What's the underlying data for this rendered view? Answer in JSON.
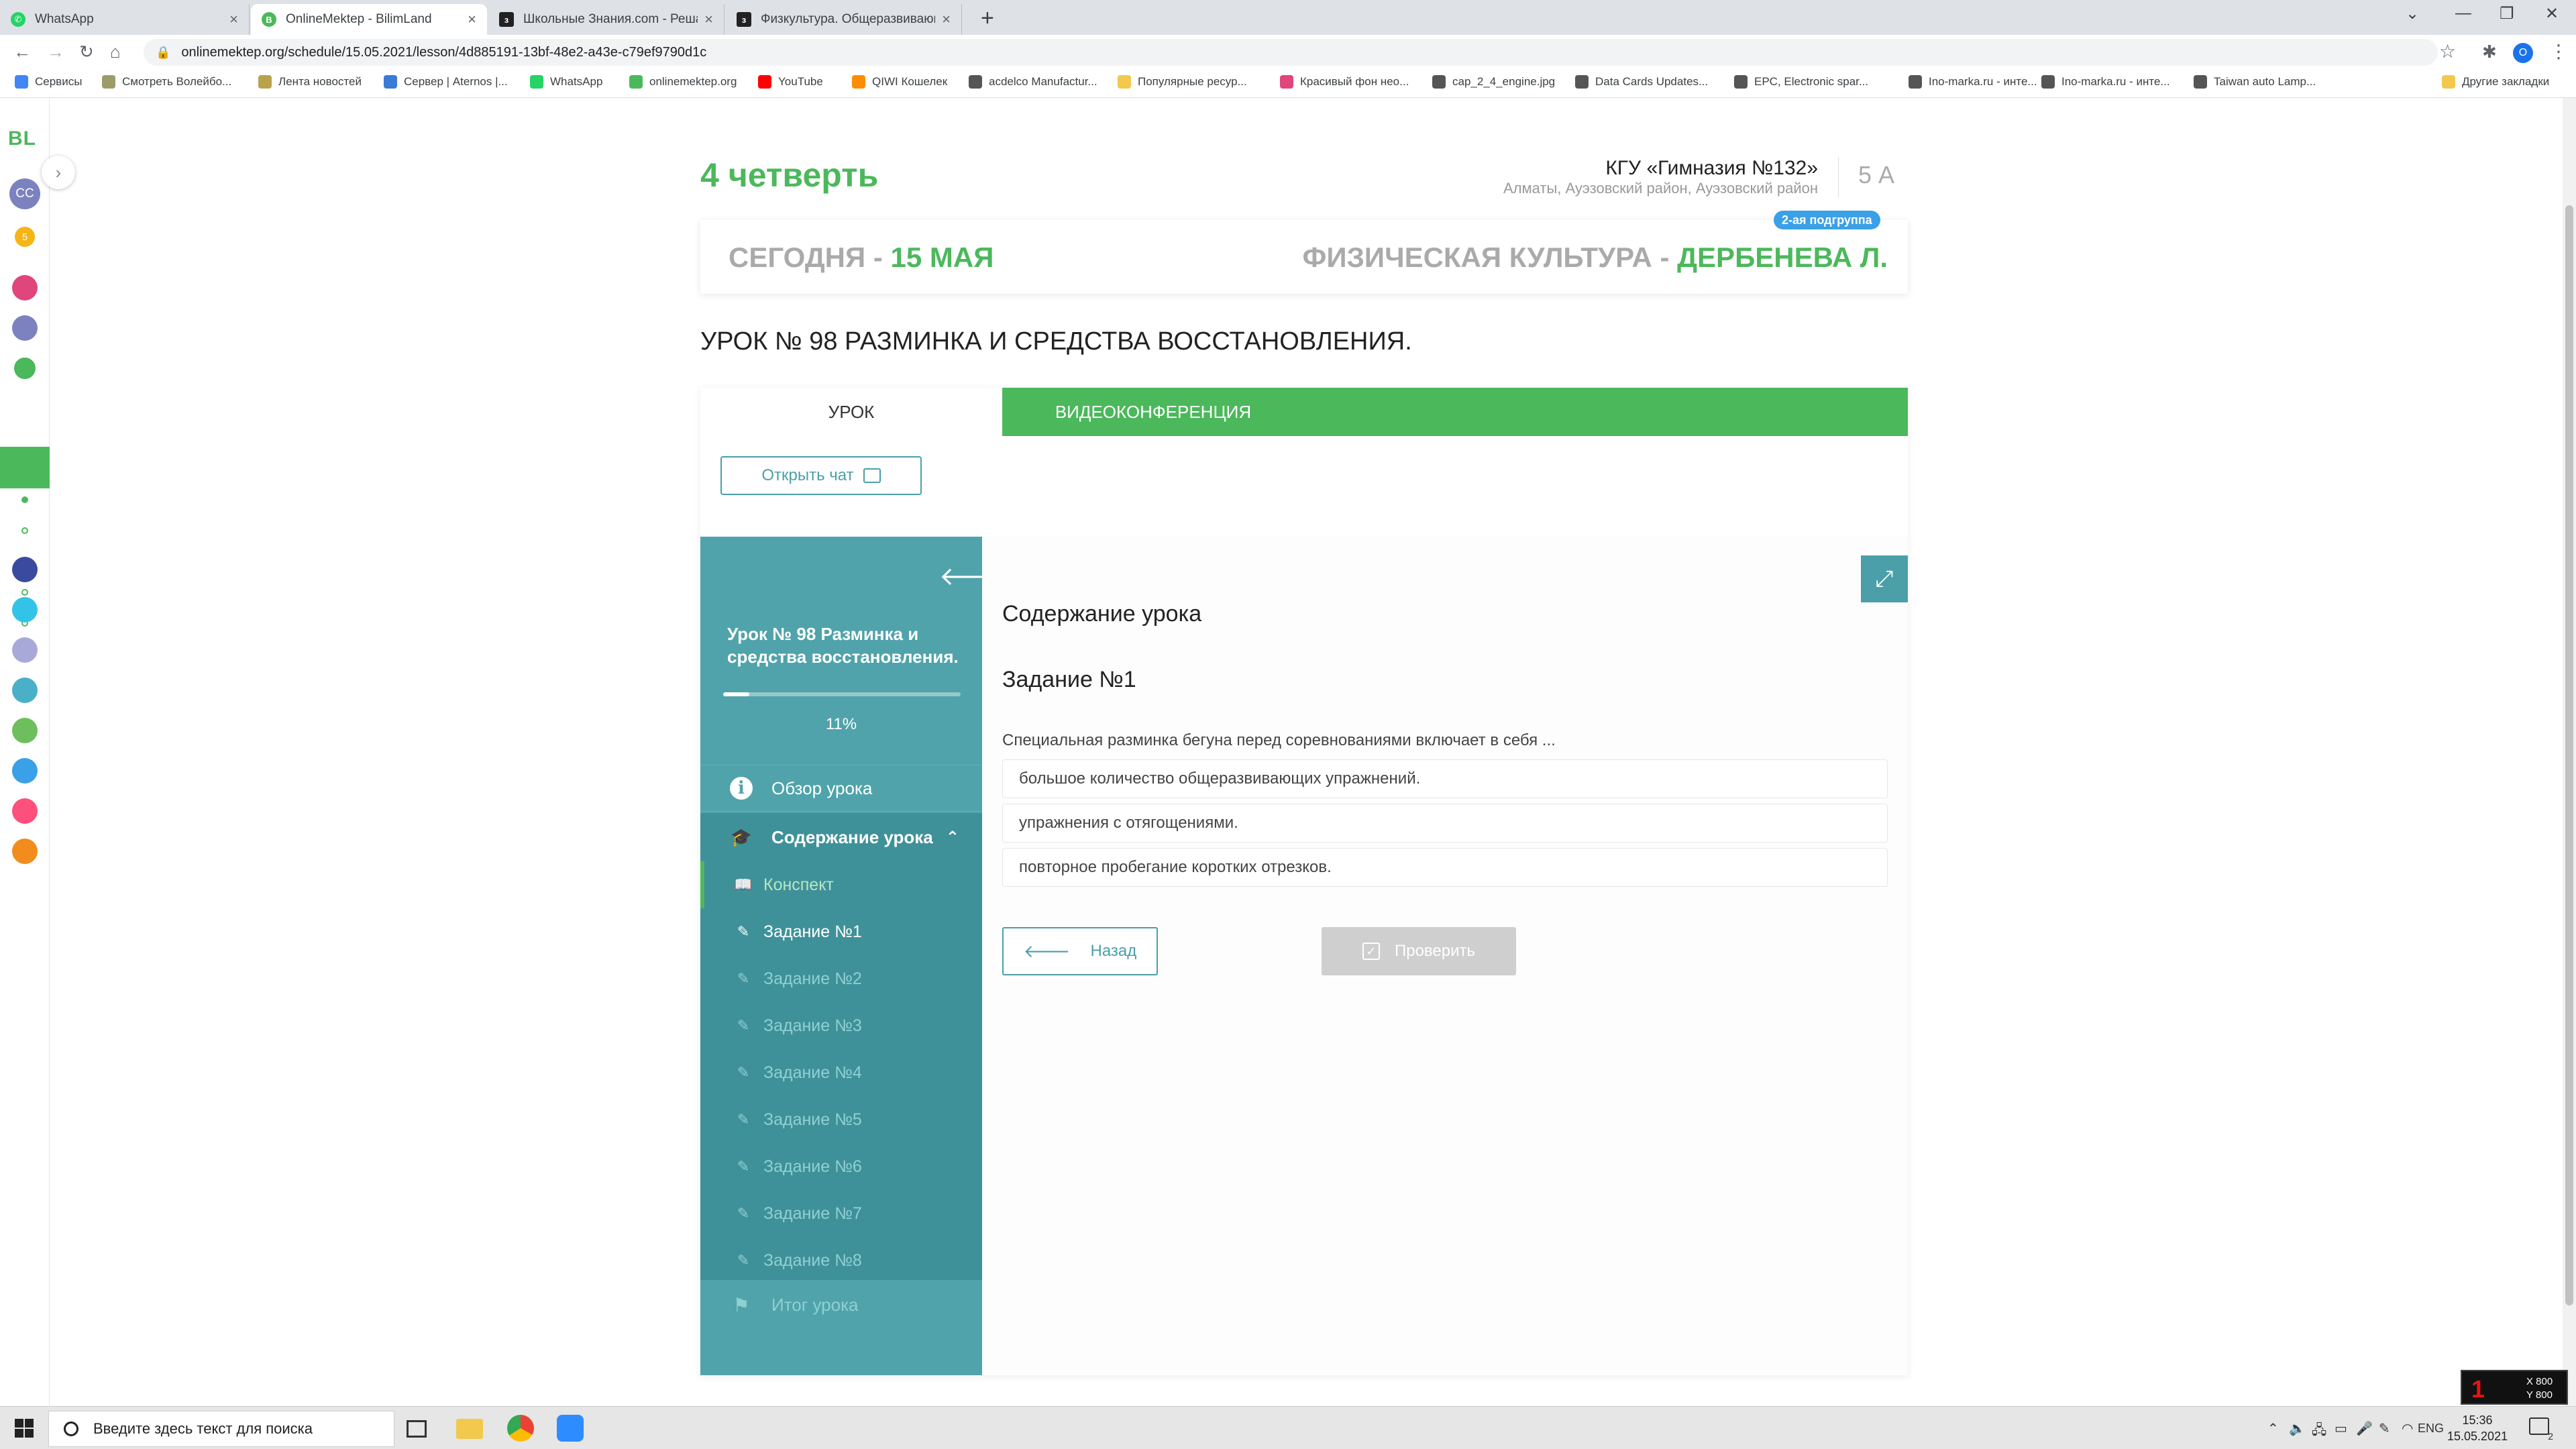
{
  "browser": {
    "tabs": [
      {
        "title": "WhatsApp",
        "icon": "whatsapp-icon",
        "color": "#25d366",
        "active": false
      },
      {
        "title": "OnlineMektep - BilimLand",
        "icon": "bilimland-icon",
        "color": "#4cb85c",
        "active": true
      },
      {
        "title": "Школьные Знания.com - Решаем",
        "icon": "znanija-icon",
        "color": "#222222",
        "active": false
      },
      {
        "title": "Физкультура. Общеразвивающие",
        "icon": "znanija-icon",
        "color": "#222222",
        "active": false
      }
    ],
    "url": "onlinemektep.org/schedule/15.05.2021/lesson/4d885191-13bf-48e2-a43e-c79ef9790d1c",
    "profile_initial": "O",
    "bookmarks": [
      {
        "label": "Сервисы",
        "color": "#4285f4"
      },
      {
        "label": "Смотреть Волейбо...",
        "color": "#9c9c6a"
      },
      {
        "label": "Лента новостей",
        "color": "#b8a24c"
      },
      {
        "label": "Сервер | Aternos |...",
        "color": "#3a7bd5"
      },
      {
        "label": "WhatsApp",
        "color": "#25d366"
      },
      {
        "label": "onlinemektep.org",
        "color": "#4cb85c"
      },
      {
        "label": "YouTube",
        "color": "#ff0000"
      },
      {
        "label": "QIWI Кошелек",
        "color": "#ff8c00"
      },
      {
        "label": "acdelco Manufactur...",
        "color": "#555555"
      },
      {
        "label": "Популярные ресур...",
        "color": "#f2c94c"
      },
      {
        "label": "Красивый фон нео...",
        "color": "#e0457b"
      },
      {
        "label": "cap_2_4_engine.jpg",
        "color": "#555555"
      },
      {
        "label": "Data Cards Updates...",
        "color": "#555555"
      },
      {
        "label": "EPC, Electronic spar...",
        "color": "#555555"
      },
      {
        "label": "Ino-marka.ru - инте...",
        "color": "#555555"
      },
      {
        "label": "Ino-marka.ru - инте...",
        "color": "#555555"
      },
      {
        "label": "Taiwan auto Lamp...",
        "color": "#555555"
      },
      {
        "label": "Другие закладки",
        "color": "#f2c94c"
      }
    ]
  },
  "rail": {
    "logo": "BL",
    "avatar": "CC",
    "coins": "5",
    "app_colors": [
      "#e0457b",
      "#7b82bf",
      "#4cb85c",
      "#3a4a9f",
      "#33c3e8",
      "#a9a9d9",
      "#4ab0c8",
      "#6cbf5c",
      "#3aa0e8",
      "#ff4f7b",
      "#f28c1c"
    ]
  },
  "header": {
    "quarter": "4 четверть",
    "school": "КГУ «Гимназия №132»",
    "address": "Алматы, Ауэзовский район, Ауэзовский район",
    "class": "5 А"
  },
  "date_card": {
    "today_prefix": "СЕГОДНЯ - ",
    "today_date": "15 МАЯ",
    "subject_prefix": "ФИЗИЧЕСКАЯ КУЛЬТУРА - ",
    "teacher": "ДЕРБЕНЕВА Л.",
    "subgroup": "2-ая подгруппа"
  },
  "lesson": {
    "title": "УРОК № 98 РАЗМИНКА И СРЕДСТВА ВОССТАНОВЛЕНИЯ.",
    "tabs": {
      "lesson": "УРОК",
      "video": "ВИДЕОКОНФЕРЕНЦИЯ"
    },
    "open_chat": "Открыть чат"
  },
  "sidebar": {
    "lesson_title": "Урок № 98 Разминка и средства восстановления.",
    "progress_text": "11%",
    "progress_fraction": 0.11,
    "overview": "Обзор урока",
    "content_group": "Содержание урока",
    "items": [
      {
        "label": "Конспект",
        "type": "konspekt"
      },
      {
        "label": "Задание №1",
        "type": "current"
      },
      {
        "label": "Задание №2",
        "type": "task"
      },
      {
        "label": "Задание №3",
        "type": "task"
      },
      {
        "label": "Задание №4",
        "type": "task"
      },
      {
        "label": "Задание №5",
        "type": "task"
      },
      {
        "label": "Задание №6",
        "type": "task"
      },
      {
        "label": "Задание №7",
        "type": "task"
      },
      {
        "label": "Задание №8",
        "type": "task"
      }
    ],
    "summary": "Итог урока"
  },
  "content": {
    "heading": "Содержание урока",
    "task": "Задание №1",
    "question": "Специальная разминка бегуна перед соревнованиями включает в себя ...",
    "answers": [
      "большое количество общеразвивающих упражнений.",
      "упражнения с отягощениями.",
      "повторное пробегание коротких отрезков."
    ],
    "back": "Назад",
    "check": "Проверить"
  },
  "taskbar": {
    "search_placeholder": "Введите здесь текст для поиска",
    "lang": "ENG",
    "time": "15:36",
    "date": "15.05.2021",
    "notifications": "2",
    "overlay": {
      "value": "1",
      "x": "X 800",
      "y": "Y 800"
    }
  }
}
